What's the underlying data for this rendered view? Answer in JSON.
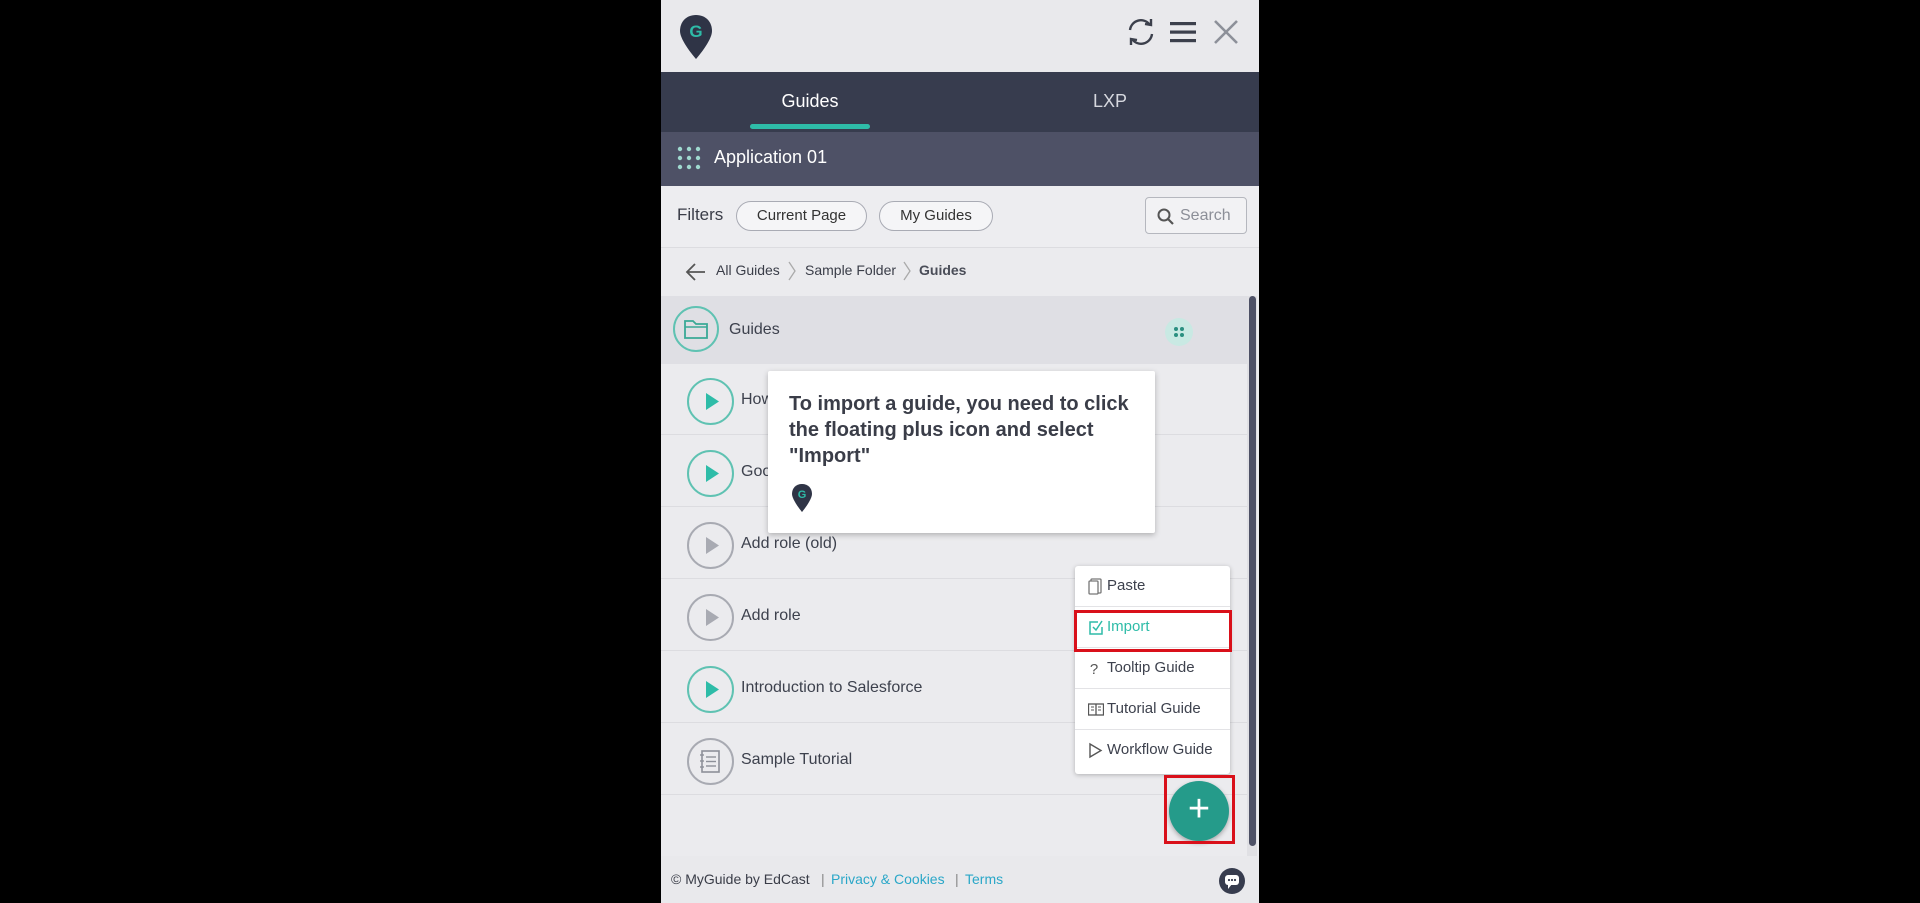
{
  "colors": {
    "accent": "#2ebca8",
    "dark": "#373c4e",
    "highlight": "#d9101a",
    "fab": "#259b8a"
  },
  "header": {
    "icons": [
      "myguide-logo-icon",
      "sync-icon",
      "hamburger-menu-icon",
      "close-icon"
    ]
  },
  "tabs": [
    {
      "label": "Guides",
      "active": true
    },
    {
      "label": "LXP",
      "active": false
    }
  ],
  "app": {
    "name": "Application 01"
  },
  "filters": {
    "label": "Filters",
    "chips": [
      "Current Page",
      "My Guides"
    ],
    "search_placeholder": "Search"
  },
  "breadcrumb": [
    "All Guides",
    "Sample Folder",
    "Guides"
  ],
  "list": {
    "folder": "Guides",
    "items": [
      {
        "label": "How",
        "icon": "play-icon",
        "active": true
      },
      {
        "label": "Goo",
        "icon": "play-icon",
        "active": true
      },
      {
        "label": "Add role (old)",
        "icon": "play-icon",
        "active": false
      },
      {
        "label": "Add role",
        "icon": "play-icon",
        "active": false
      },
      {
        "label": "Introduction to Salesforce",
        "icon": "play-icon",
        "active": true
      },
      {
        "label": "Sample Tutorial",
        "icon": "notebook-icon",
        "active": false
      }
    ]
  },
  "tooltip": {
    "text": "To import a guide, you need to click the floating plus icon and select \"Import\""
  },
  "menu": {
    "items": [
      {
        "label": "Paste",
        "icon": "paste-icon"
      },
      {
        "label": "Import",
        "icon": "import-icon",
        "highlighted": true
      },
      {
        "label": "Tooltip Guide",
        "icon": "question-icon"
      },
      {
        "label": "Tutorial Guide",
        "icon": "book-icon"
      },
      {
        "label": "Workflow Guide",
        "icon": "play-outline-icon"
      }
    ]
  },
  "fab": {
    "label": "+"
  },
  "footer": {
    "copyright": "© MyGuide by EdCast",
    "sep": "|",
    "privacy": "Privacy & Cookies",
    "terms": "Terms"
  }
}
